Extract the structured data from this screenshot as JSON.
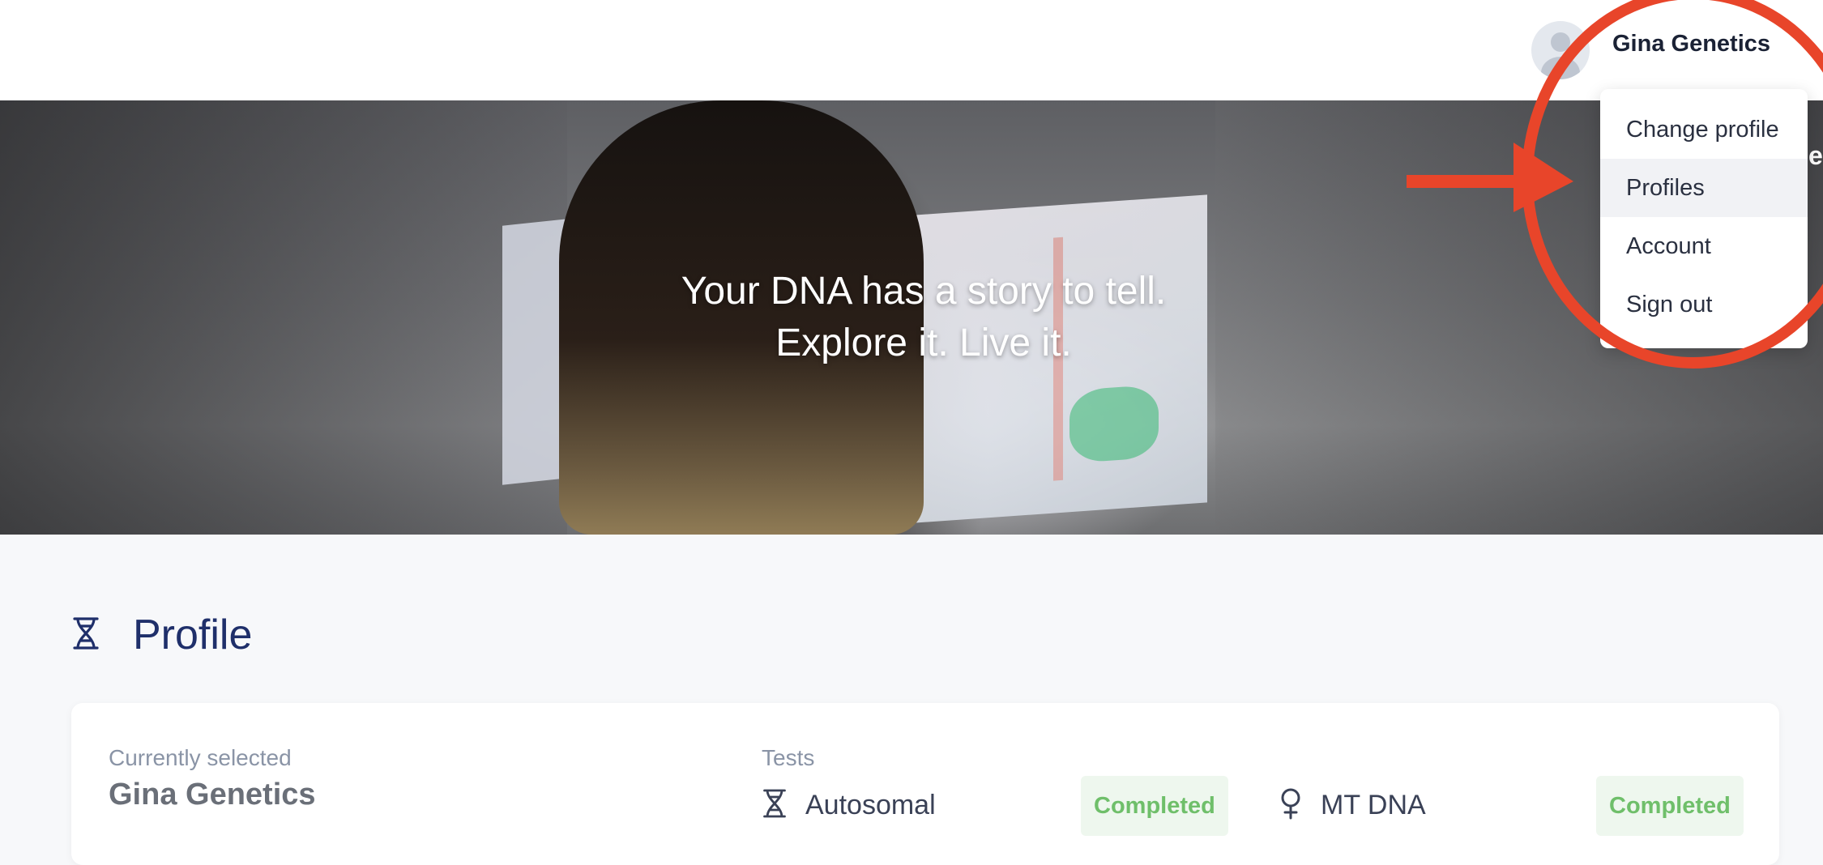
{
  "header": {
    "user_name": "Gina Genetics",
    "avatar_icon": "user-avatar-icon"
  },
  "user_menu": {
    "items": [
      {
        "label": "Change profile"
      },
      {
        "label": "Profiles"
      },
      {
        "label": "Account"
      },
      {
        "label": "Sign out"
      }
    ],
    "active_item": "Profiles",
    "clipped_text": "e"
  },
  "hero": {
    "line1": "Your DNA has a story to tell.",
    "line2": "Explore it. Live it."
  },
  "profile_section": {
    "title": "Profile",
    "icon": "dna-icon",
    "currently_selected_label": "Currently selected",
    "currently_selected_name": "Gina Genetics",
    "tests_label": "Tests",
    "tests": [
      {
        "name": "Autosomal",
        "status": "Completed",
        "icon": "dna-icon"
      },
      {
        "name": "MT DNA",
        "status": "Completed",
        "icon": "female-symbol-icon"
      }
    ]
  },
  "colors": {
    "accent_title": "#1f2f6a",
    "annotation_red": "#e8452a",
    "status_green": "#6fbf6a",
    "status_green_bg": "#eef7ee"
  }
}
